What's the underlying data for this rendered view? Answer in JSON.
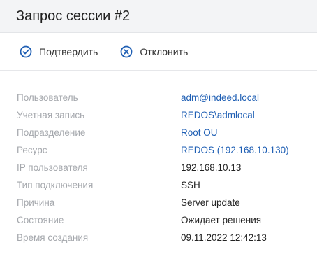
{
  "header": {
    "title": "Запрос сессии #2"
  },
  "toolbar": {
    "approve_label": "Подтвердить",
    "reject_label": "Отклонить",
    "accent": "#1f5fb4"
  },
  "details": {
    "user_label": "Пользователь",
    "user_value": "adm@indeed.local",
    "account_label": "Учетная запись",
    "account_value": "REDOS\\admlocal",
    "division_label": "Подразделение",
    "division_value": "Root OU",
    "resource_label": "Ресурс",
    "resource_value": "REDOS (192.168.10.130)",
    "ip_label": "IP пользователя",
    "ip_value": "192.168.10.13",
    "conn_type_label": "Тип подключения",
    "conn_type_value": "SSH",
    "reason_label": "Причина",
    "reason_value": "Server update",
    "state_label": "Состояние",
    "state_value": "Ожидает решения",
    "created_label": "Время создания",
    "created_value": "09.11.2022 12:42:13"
  }
}
